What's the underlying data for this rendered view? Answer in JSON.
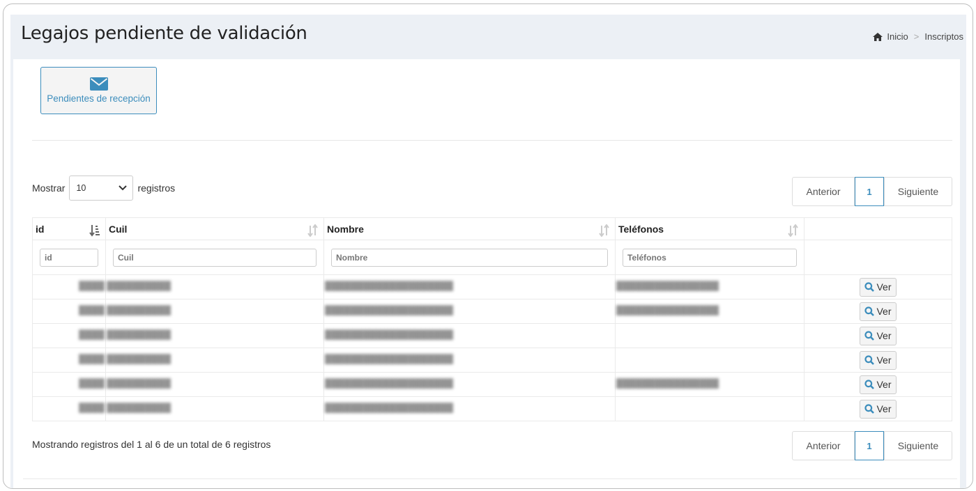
{
  "header": {
    "title": "Legajos pendiente de validación",
    "breadcrumb": [
      "Inicio",
      "Inscriptos"
    ]
  },
  "tile": {
    "label": "Pendientes de recepción",
    "icon": "envelope-icon"
  },
  "length_menu": {
    "prefix": "Mostrar",
    "value": "10",
    "suffix": "registros"
  },
  "pagination": {
    "prev": "Anterior",
    "current": "1",
    "next": "Siguiente"
  },
  "table": {
    "columns": [
      "id",
      "Cuil",
      "Nombre",
      "Teléfonos"
    ],
    "filters": [
      "id",
      "Cuil",
      "Nombre",
      "Teléfonos"
    ],
    "rows": [
      {
        "id": "████",
        "cuil": "██████████",
        "nombre": "████████████████████",
        "telefonos": "████████████████"
      },
      {
        "id": "████",
        "cuil": "██████████",
        "nombre": "████████████████████",
        "telefonos": "████████████████"
      },
      {
        "id": "████",
        "cuil": "██████████",
        "nombre": "████████████████████",
        "telefonos": ""
      },
      {
        "id": "████",
        "cuil": "██████████",
        "nombre": "████████████████████",
        "telefonos": ""
      },
      {
        "id": "████",
        "cuil": "██████████",
        "nombre": "████████████████████",
        "telefonos": "████████████████"
      },
      {
        "id": "████",
        "cuil": "██████████",
        "nombre": "████████████████████",
        "telefonos": ""
      }
    ],
    "action_label": "Ver"
  },
  "info": "Mostrando registros del 1 al 6 de un total de 6 registros",
  "colors": {
    "accent": "#3c8dbc",
    "header_bg": "#ecf0f5"
  }
}
